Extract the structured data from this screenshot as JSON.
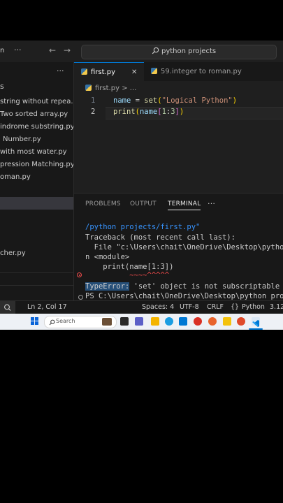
{
  "titlebar": {
    "partial_label": "n",
    "more": "···",
    "back": "←",
    "forward": "→",
    "search": "python projects"
  },
  "sidebar": {
    "more": "···",
    "section_partial": "s",
    "items": [
      {
        "label": "string without repea..."
      },
      {
        "label": "Two sorted array.py"
      },
      {
        "label": "indrome substring.py"
      },
      {
        "label": "Number.py"
      },
      {
        "label": "with most water.py"
      },
      {
        "label": "pression Matching.py"
      },
      {
        "label": "oman.py"
      },
      {
        "label": ""
      },
      {
        "label": ""
      },
      {
        "label": ""
      },
      {
        "label": ""
      },
      {
        "label": "cher.py"
      }
    ]
  },
  "tabs": [
    {
      "label": "first.py",
      "close": "✕",
      "active": true
    },
    {
      "label": "59.integer to roman.py",
      "active": false
    }
  ],
  "breadcrumb": {
    "file": "first.py",
    "sep": ">",
    "more": "..."
  },
  "editor": {
    "lines": [
      {
        "number": "1"
      },
      {
        "number": "2"
      }
    ]
  },
  "panel": {
    "tabs": [
      "PROBLEMS",
      "OUTPUT",
      "TERMINAL",
      "···"
    ],
    "terminal": [
      "/python projects/first.py\"",
      "Traceback (most recent call last):",
      "  File \"c:\\Users\\chait\\OneDrive\\Desktop\\python",
      "n <module>",
      "    print(name[1:3])",
      "          ~~~~^^^^^",
      "'set' object is not subscriptable",
      "PS C:\\Users\\chait\\OneDrive\\Desktop\\python proje"
    ],
    "error_label": "TypeError:"
  },
  "statusbar": {
    "position": "Ln 2, Col 17",
    "spaces": "Spaces: 4",
    "encoding": "UTF-8",
    "eol": "CRLF",
    "language_brace": "{}",
    "language": "Python",
    "version": "3.12"
  },
  "taskbar": {
    "search": "Search"
  },
  "colors": {
    "accent": "#0078d4",
    "error": "#f14c4c",
    "selection": "#264f78"
  }
}
